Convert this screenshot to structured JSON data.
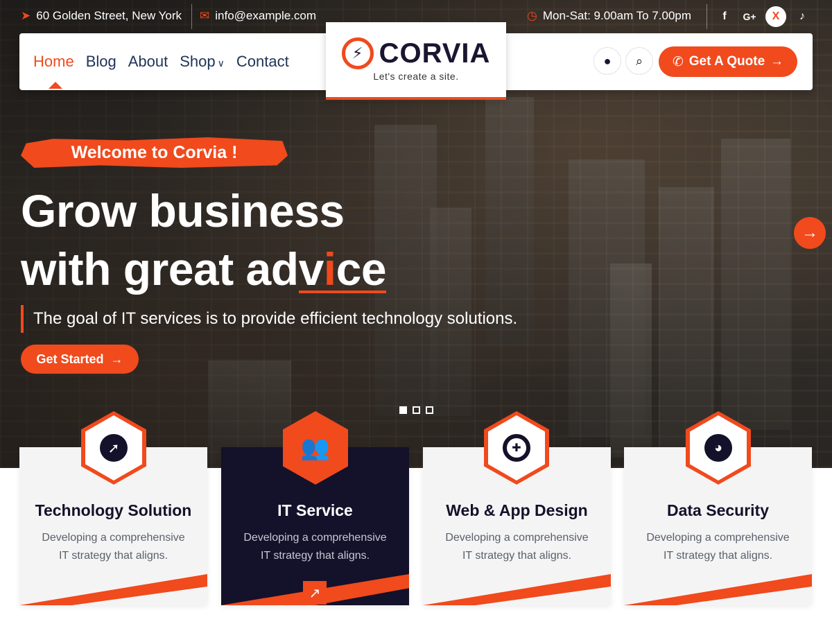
{
  "topbar": {
    "address": "60 Golden Street, New York",
    "email": "info@example.com",
    "hours": "Mon-Sat: 9.00am To 7.00pm",
    "social": [
      "f",
      "G+",
      "X",
      "♪"
    ]
  },
  "nav": {
    "items": [
      "Home",
      "Blog",
      "About",
      "Shop",
      "Contact"
    ],
    "active": "Home"
  },
  "logo": {
    "name": "CORVIA",
    "tagline": "Let's create a site."
  },
  "header": {
    "quote_label": "Get A Quote"
  },
  "hero": {
    "badge": "Welcome to Corvia !",
    "headline_line1": "Grow business",
    "headline_line2_pre": "with great ad",
    "headline_hl_a": "v",
    "headline_hl_b": "i",
    "headline_hl_c": "ce",
    "subtitle": "The goal of IT services is to provide efficient technology solutions.",
    "cta": "Get Started",
    "slides": 3,
    "active_slide": 1
  },
  "services": [
    {
      "title": "Technology Solution",
      "desc_line1": "Developing a comprehensive",
      "desc_line2": "IT strategy that aligns.",
      "icon": "compass-icon"
    },
    {
      "title": "IT Service",
      "desc_line1": "Developing a comprehensive",
      "desc_line2": "IT strategy that aligns.",
      "icon": "users-icon"
    },
    {
      "title": "Web & App Design",
      "desc_line1": "Developing a comprehensive",
      "desc_line2": "IT strategy that aligns.",
      "icon": "lifebuoy-icon"
    },
    {
      "title": "Data Security",
      "desc_line1": "Developing a comprehensive",
      "desc_line2": "IT strategy that aligns.",
      "icon": "pie-chart-icon"
    }
  ],
  "colors": {
    "accent": "#f04a1d",
    "navy": "#14112a",
    "nav_text": "#1f3357"
  }
}
